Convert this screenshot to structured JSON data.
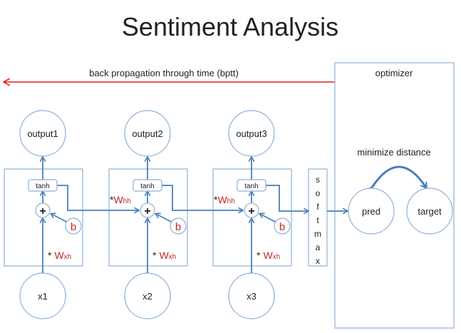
{
  "title": "Sentiment Analysis",
  "bptt_label": "back propagation through time (bptt)",
  "optimizer_label": "optimizer",
  "minimize_label": "minimize distance",
  "pred_label": "pred",
  "target_label": "target",
  "softmax_letters": [
    "s",
    "o",
    "f",
    "t",
    "m",
    "a",
    "x"
  ],
  "cells": [
    {
      "output": "output1",
      "input": "x1",
      "activation": "tanh",
      "bias": "b",
      "plus": "+",
      "wxh_star": "*",
      "wxh": "W",
      "wxh_sub": "xh"
    },
    {
      "output": "output2",
      "input": "x2",
      "activation": "tanh",
      "bias": "b",
      "plus": "+",
      "wxh_star": "*",
      "wxh": "W",
      "wxh_sub": "xh"
    },
    {
      "output": "output3",
      "input": "x3",
      "activation": "tanh",
      "bias": "b",
      "plus": "+",
      "wxh_star": "*",
      "wxh": "W",
      "wxh_sub": "xh"
    }
  ],
  "whh": {
    "star": "*",
    "w": "W",
    "sub": "hh"
  },
  "colors": {
    "arrow_blue": "#4a7ebb",
    "bptt_red": "#e02020",
    "weight_red": "#c0282a",
    "node_border": "#8fb0d8"
  }
}
